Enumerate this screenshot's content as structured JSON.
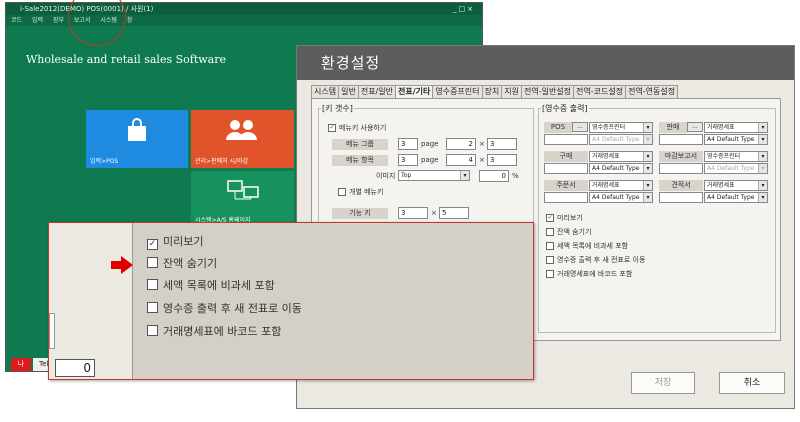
{
  "background_app": {
    "title": "i-Sale2012(DEMO)    POS(0001) / 사원(1)",
    "window_buttons": "_□×",
    "menu": [
      "코드",
      "입력",
      "장부",
      "보고서",
      "시스템",
      "창"
    ],
    "tagline": "Wholesale and retail sales Software",
    "tiles": [
      {
        "label": "입력>POS",
        "color": "#1e8be0",
        "icon": "shopping-bag-icon"
      },
      {
        "label": "관리>판매처 시/마감",
        "color": "#e0532b",
        "icon": "people-icon"
      },
      {
        "label": "시스템>A/S 홈페이지",
        "color": "#17925f",
        "icon": "network-icon"
      }
    ],
    "status_red_label": "나",
    "status_tab_label": "Tel",
    "zero_value": "0"
  },
  "dialog": {
    "title": "환경설정",
    "tabs": [
      "시스템",
      "일반",
      "전표/일반",
      "전표/기타",
      "영수증프린터",
      "장치",
      "지원",
      "전역-일반설정",
      "전역-코드설정",
      "전역-연동설정"
    ],
    "active_tab": "전표/기타",
    "key_group": {
      "legend": "[키 갯수]",
      "use_menu_key": "메뉴키 사용하기",
      "menu_group_label": "메뉴 그룹",
      "menu_group_value": "3",
      "page_label": "page",
      "menu_group_page": "2",
      "menu_group_cols": "3",
      "menu_item_label": "메뉴 항목",
      "menu_item_value": "3",
      "menu_item_page": "4",
      "menu_item_cols": "3",
      "times": "×",
      "image_label": "이미지",
      "image_position": "Top",
      "image_percent": "0",
      "percent": "%",
      "separate_menu_key": "개별 메뉴키",
      "func_key_label": "기능 키",
      "func_key_rows": "3",
      "func_key_cols": "5"
    },
    "receipt_group": {
      "legend": "[영수증 출력]",
      "dots": "...",
      "rows": [
        {
          "left_label": "POS",
          "left_value": "영수증프린터",
          "right_label": "판매",
          "right_value": "거래명세표"
        },
        {
          "left_label": "구매",
          "left_value": "거래명세표",
          "right_label": "마감보고서",
          "right_value": "영수증프린터"
        },
        {
          "left_label": "주문서",
          "left_value": "거래명세표",
          "right_label": "견적서",
          "right_value": "거래명세표"
        }
      ],
      "paper_type": "A4 Default Type",
      "options": [
        {
          "label": "미리보기",
          "checked": true
        },
        {
          "label": "잔액 숨기기",
          "checked": false
        },
        {
          "label": "세액 목록에 비과세 포함",
          "checked": false
        },
        {
          "label": "영수증 출력 후 새 전표로 이동",
          "checked": false
        },
        {
          "label": "거래명세표에 바코드 포함",
          "checked": false
        }
      ]
    },
    "save_label": "저장",
    "cancel_label": "취소"
  },
  "zoom": {
    "options": [
      {
        "label": "미리보기",
        "checked": true
      },
      {
        "label": "잔액 숨기기",
        "checked": false
      },
      {
        "label": "세액 목록에 비과세 포함",
        "checked": false
      },
      {
        "label": "영수증 출력 후 새 전표로 이동",
        "checked": false
      },
      {
        "label": "거래명세표에 바코드 포함",
        "checked": false
      }
    ],
    "highlight_color": "#e00000"
  }
}
